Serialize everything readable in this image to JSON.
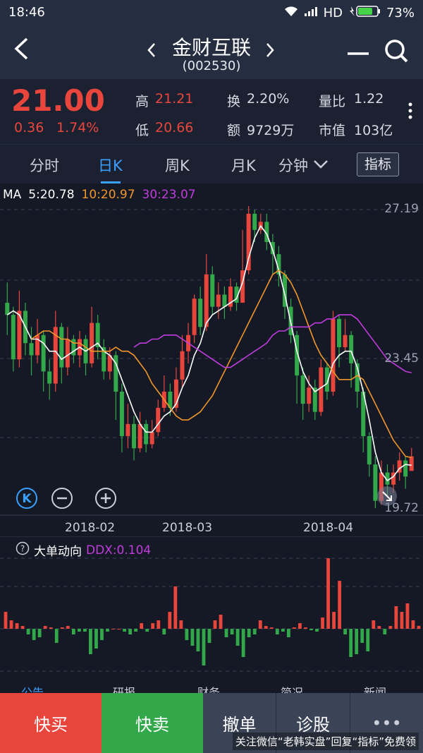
{
  "status_bar": {
    "time": "18:46",
    "network": "HD",
    "battery": "73%"
  },
  "header": {
    "title": "金财互联",
    "code": "(002530)"
  },
  "quote": {
    "price": "21.00",
    "change": "0.36",
    "change_pct": "1.74%",
    "high_label": "高",
    "high": "21.21",
    "low_label": "低",
    "low": "20.66",
    "turnover_label": "换",
    "turnover": "2.20%",
    "amount_label": "额",
    "amount": "9729万",
    "volume_ratio_label": "量比",
    "volume_ratio": "1.22",
    "market_cap_label": "市值",
    "market_cap": "103亿"
  },
  "tabs": [
    "分时",
    "日K",
    "周K",
    "月K",
    "分钟"
  ],
  "indicator_label": "指标",
  "ma_legend": {
    "ma": "MA",
    "ma5": "5:20.78",
    "ma10": "10:20.97",
    "ma30": "30:23.07"
  },
  "price_axis": {
    "top": "27.19",
    "mid": "23.45",
    "bottom": "19.72"
  },
  "date_labels": [
    "2018-02",
    "2018-03",
    "2018-04"
  ],
  "ddx_header": {
    "title": "大单动向",
    "value": "DDX:0.104"
  },
  "bottom_tabs_partial": [
    "公告",
    "研报",
    "财务",
    "简况",
    "新闻"
  ],
  "buttons": {
    "buy": "快买",
    "sell": "快卖",
    "cancel": "撤单",
    "diagnose": "诊股",
    "more": "•••"
  },
  "watermark": "关注微信“老韩实盘”回复“指标”免费领",
  "colors": {
    "up": "#e8463c",
    "down": "#32a84a",
    "ma5": "#ffffff",
    "ma10": "#f0962a",
    "ma30": "#c13cdc",
    "accent": "#3aa0ff"
  },
  "chart_data": [
    {
      "type": "candlestick",
      "title": "MA",
      "ylim": [
        19.72,
        27.19
      ],
      "x_ticks": [
        "2018-02",
        "2018-03",
        "2018-04"
      ],
      "candles": [
        [
          24.8,
          24.5,
          25.3,
          24.0
        ],
        [
          24.5,
          23.4,
          24.7,
          23.1
        ],
        [
          23.4,
          24.6,
          25.1,
          23.2
        ],
        [
          24.6,
          23.8,
          24.8,
          23.5
        ],
        [
          23.8,
          23.5,
          24.2,
          23.0
        ],
        [
          23.5,
          24.0,
          24.4,
          23.3
        ],
        [
          24.0,
          23.1,
          24.1,
          22.6
        ],
        [
          23.1,
          22.8,
          23.4,
          22.4
        ],
        [
          22.8,
          24.2,
          24.6,
          22.6
        ],
        [
          24.2,
          23.2,
          24.3,
          22.8
        ],
        [
          23.2,
          23.9,
          24.2,
          23.0
        ],
        [
          23.9,
          23.5,
          24.0,
          23.3
        ],
        [
          23.5,
          23.9,
          24.1,
          23.2
        ],
        [
          23.9,
          23.3,
          24.0,
          23.0
        ],
        [
          23.3,
          24.3,
          24.7,
          23.2
        ],
        [
          24.3,
          23.7,
          24.5,
          23.4
        ],
        [
          23.7,
          23.1,
          23.9,
          22.9
        ],
        [
          23.1,
          23.5,
          23.7,
          22.9
        ],
        [
          23.5,
          22.6,
          23.6,
          21.9
        ],
        [
          22.6,
          21.5,
          22.8,
          21.1
        ],
        [
          21.5,
          21.8,
          22.3,
          21.2
        ],
        [
          21.8,
          21.2,
          22.0,
          20.9
        ],
        [
          21.2,
          21.8,
          22.1,
          21.1
        ],
        [
          21.8,
          21.3,
          21.9,
          21.1
        ],
        [
          21.3,
          21.6,
          21.9,
          21.2
        ],
        [
          21.6,
          22.2,
          22.4,
          21.5
        ],
        [
          22.2,
          22.6,
          23.0,
          22.1
        ],
        [
          22.6,
          22.2,
          22.8,
          22.0
        ],
        [
          22.2,
          22.9,
          23.2,
          22.1
        ],
        [
          22.9,
          23.6,
          24.0,
          22.7
        ],
        [
          23.6,
          24.0,
          24.3,
          23.3
        ],
        [
          24.0,
          24.9,
          25.0,
          23.8
        ],
        [
          24.9,
          24.2,
          25.2,
          24.0
        ],
        [
          24.2,
          25.5,
          26.0,
          24.1
        ],
        [
          25.5,
          24.7,
          25.7,
          24.5
        ],
        [
          24.7,
          25.0,
          25.3,
          24.4
        ],
        [
          25.0,
          24.7,
          25.2,
          24.4
        ],
        [
          24.7,
          25.2,
          25.4,
          24.6
        ],
        [
          25.2,
          24.8,
          25.3,
          24.6
        ],
        [
          24.8,
          25.6,
          26.6,
          24.8
        ],
        [
          25.6,
          27.0,
          27.19,
          25.5
        ],
        [
          27.0,
          26.6,
          27.1,
          26.3
        ],
        [
          26.6,
          26.8,
          27.0,
          26.5
        ],
        [
          26.8,
          26.3,
          27.0,
          26.1
        ],
        [
          26.3,
          26.0,
          26.5,
          25.5
        ],
        [
          26.0,
          25.5,
          26.2,
          25.2
        ],
        [
          25.5,
          24.7,
          25.6,
          24.4
        ],
        [
          24.7,
          24.0,
          24.9,
          23.8
        ],
        [
          24.0,
          23.0,
          24.1,
          22.3
        ],
        [
          23.0,
          22.3,
          23.2,
          21.9
        ],
        [
          22.3,
          22.7,
          23.0,
          22.1
        ],
        [
          22.7,
          22.1,
          22.9,
          21.9
        ],
        [
          22.1,
          23.2,
          23.4,
          22.0
        ],
        [
          23.2,
          22.6,
          23.3,
          22.4
        ],
        [
          22.6,
          24.4,
          24.6,
          22.5
        ],
        [
          24.4,
          23.7,
          24.5,
          23.2
        ],
        [
          23.7,
          24.0,
          24.4,
          23.6
        ],
        [
          24.0,
          23.3,
          24.1,
          22.7
        ],
        [
          23.3,
          22.6,
          23.4,
          22.2
        ],
        [
          22.6,
          21.5,
          22.7,
          21.1
        ],
        [
          21.5,
          20.8,
          21.6,
          20.5
        ],
        [
          20.8,
          19.9,
          21.0,
          19.72
        ],
        [
          19.9,
          20.6,
          20.9,
          19.8
        ],
        [
          20.6,
          20.3,
          20.8,
          20.0
        ],
        [
          20.3,
          20.6,
          20.8,
          20.1
        ],
        [
          20.6,
          20.9,
          21.1,
          20.4
        ],
        [
          20.9,
          20.5,
          21.0,
          20.2
        ],
        [
          20.64,
          21.0,
          21.21,
          20.66
        ]
      ],
      "series": [
        {
          "name": "5",
          "values": [
            24.5,
            24.6,
            24.5,
            24.2,
            23.9,
            23.9,
            23.8,
            23.6,
            23.6,
            23.4,
            23.5,
            23.6,
            23.7,
            23.6,
            23.7,
            23.8,
            23.6,
            23.5,
            23.3,
            22.9,
            22.5,
            22.1,
            21.8,
            21.6,
            21.6,
            21.8,
            22.0,
            22.1,
            22.3,
            22.7,
            23.0,
            23.5,
            23.8,
            24.3,
            24.5,
            24.6,
            24.7,
            24.8,
            24.9,
            25.3,
            25.9,
            26.4,
            26.7,
            26.5,
            26.1,
            25.6,
            25.0,
            24.3,
            23.6,
            23.1,
            22.8,
            22.6,
            22.7,
            22.8,
            23.3,
            23.5,
            23.6,
            23.6,
            23.2,
            22.6,
            21.9,
            21.1,
            20.6,
            20.4,
            20.5,
            20.7,
            20.8,
            20.78
          ]
        },
        {
          "name": "10",
          "values": [
            23.9,
            24.0,
            24.1,
            24.1,
            24.0,
            23.9,
            23.9,
            23.8,
            23.8,
            23.7,
            23.6,
            23.6,
            23.6,
            23.6,
            23.7,
            23.6,
            23.6,
            23.5,
            23.3,
            23.1,
            22.8,
            22.6,
            22.4,
            22.2,
            22.0,
            21.9,
            21.9,
            22.0,
            22.1,
            22.3,
            22.5,
            22.8,
            23.1,
            23.4,
            23.7,
            24.0,
            24.3,
            24.6,
            24.9,
            25.2,
            25.5,
            25.6,
            25.5,
            25.3,
            25.0,
            24.6,
            24.2,
            23.8,
            23.5,
            23.3,
            23.1,
            22.9,
            22.9,
            22.9,
            23.0,
            22.9,
            22.6,
            22.3,
            22.0,
            21.7,
            21.4,
            21.2,
            21.0,
            20.97
          ]
        },
        {
          "name": "30",
          "values": [
            23.7,
            23.8,
            23.8,
            23.9,
            23.9,
            24.0,
            24.0,
            24.0,
            23.9,
            23.8,
            23.7,
            23.6,
            23.5,
            23.4,
            23.3,
            23.2,
            23.2,
            23.3,
            23.4,
            23.5,
            23.6,
            23.7,
            23.8,
            24.0,
            24.1,
            24.1,
            24.2,
            24.2,
            24.2,
            24.2,
            24.3,
            24.3,
            24.4,
            24.4,
            24.5,
            24.5,
            24.5,
            24.4,
            24.2,
            24.0,
            23.8,
            23.6,
            23.4,
            23.3,
            23.2,
            23.1,
            23.07
          ]
        }
      ]
    },
    {
      "type": "bar",
      "title": "大单动向",
      "series": [
        {
          "name": "DDX",
          "values": [
            0.6,
            0.3,
            0.2,
            0.1,
            -0.2,
            -0.4,
            -0.3,
            0.1,
            0.05,
            -0.5,
            0.05,
            0.1,
            -0.2,
            -0.1,
            -0.1,
            -0.9,
            -0.7,
            -0.4,
            -0.1,
            0.0,
            0.0,
            -0.1,
            -0.2,
            -0.1,
            0.2,
            -0.1,
            0.2,
            0.3,
            -0.2,
            0.6,
            1.5,
            0.3,
            -0.4,
            -0.6,
            -0.8,
            -1.3,
            -0.5,
            0.3,
            0.5,
            -0.3,
            -0.2,
            -0.6,
            -1.0,
            -0.3,
            -0.2,
            0.3,
            0.1,
            0.05,
            -0.2,
            -0.1,
            -0.3,
            0.05,
            0.2,
            0.05,
            -0.05,
            -0.1,
            0.4,
            2.5,
            0.6,
            1.7,
            -0.2,
            -1.0,
            -0.9,
            -0.5,
            -0.8,
            0.3,
            0.1,
            -0.2,
            0.1,
            0.8,
            0.6,
            0.9,
            0.3,
            0.104
          ]
        }
      ]
    }
  ]
}
